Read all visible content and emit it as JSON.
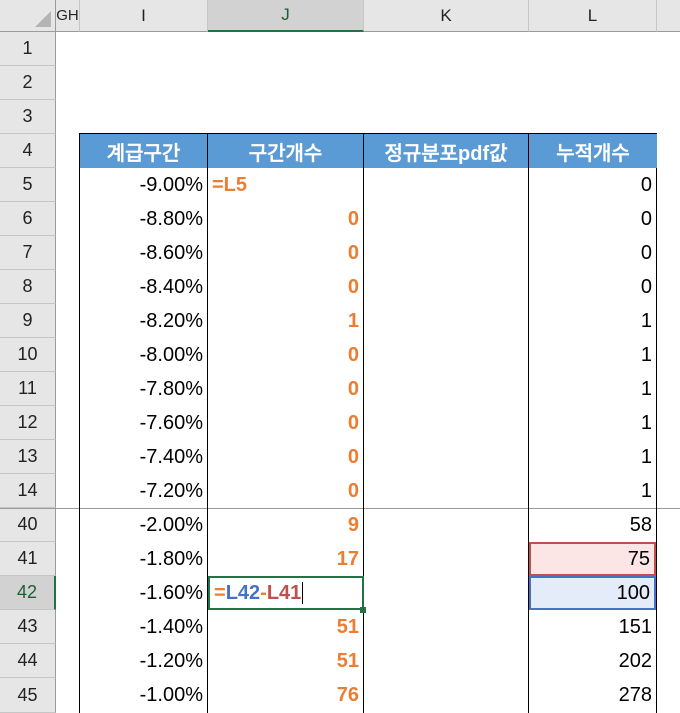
{
  "columns": {
    "gh": "GH",
    "i": "I",
    "j": "J",
    "k": "K",
    "l": "L"
  },
  "table_headers": {
    "i": "계급구간",
    "j": "구간개수",
    "k": "정규분포pdf값",
    "l": "누적개수"
  },
  "rows": [
    {
      "num": "1"
    },
    {
      "num": "2"
    },
    {
      "num": "3"
    },
    {
      "num": "4"
    },
    {
      "num": "5",
      "i": "-9.00%",
      "j": "=L5",
      "l": "0"
    },
    {
      "num": "6",
      "i": "-8.80%",
      "j": "0",
      "l": "0"
    },
    {
      "num": "7",
      "i": "-8.60%",
      "j": "0",
      "l": "0"
    },
    {
      "num": "8",
      "i": "-8.40%",
      "j": "0",
      "l": "0"
    },
    {
      "num": "9",
      "i": "-8.20%",
      "j": "1",
      "l": "1"
    },
    {
      "num": "10",
      "i": "-8.00%",
      "j": "0",
      "l": "1"
    },
    {
      "num": "11",
      "i": "-7.80%",
      "j": "0",
      "l": "1"
    },
    {
      "num": "12",
      "i": "-7.60%",
      "j": "0",
      "l": "1"
    },
    {
      "num": "13",
      "i": "-7.40%",
      "j": "0",
      "l": "1"
    },
    {
      "num": "14",
      "i": "-7.20%",
      "j": "0",
      "l": "1"
    },
    {
      "num": "40",
      "i": "-2.00%",
      "j": "9",
      "l": "58"
    },
    {
      "num": "41",
      "i": "-1.80%",
      "j": "17",
      "l": "75"
    },
    {
      "num": "42",
      "i": "-1.60%",
      "l": "100"
    },
    {
      "num": "43",
      "i": "-1.40%",
      "j": "51",
      "l": "151"
    },
    {
      "num": "44",
      "i": "-1.20%",
      "j": "51",
      "l": "202"
    },
    {
      "num": "45",
      "i": "-1.00%",
      "j": "76",
      "l": "278"
    }
  ],
  "formula_42": {
    "eq": "=",
    "ref1": "L42",
    "minus": "-",
    "ref2": "L41"
  },
  "colors": {
    "header_fill": "#5b9bd5",
    "orange_text": "#ed7d31",
    "ref_blue": "#4472c4",
    "ref_red": "#c0504d",
    "selection_green": "#217346"
  }
}
